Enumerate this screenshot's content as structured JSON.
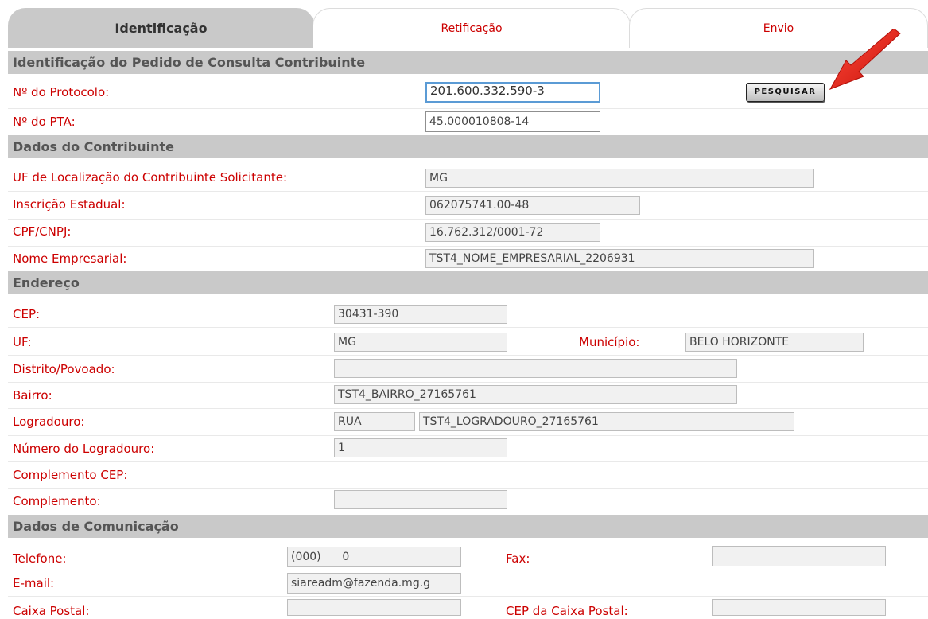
{
  "tabs": [
    {
      "label": "Identificação",
      "active": true
    },
    {
      "label": "Retificação",
      "active": false
    },
    {
      "label": "Envio",
      "active": false
    }
  ],
  "sections": {
    "identificacao": "Identificação do Pedido de Consulta Contribuinte",
    "contribuinte": "Dados do Contribuinte",
    "endereco": "Endereço",
    "comunicacao": "Dados de Comunicação"
  },
  "identificacao": {
    "protocolo_label": "Nº do Protocolo:",
    "protocolo_value": "201.600.332.590-3",
    "pta_label": "Nº do PTA:",
    "pta_value": "45.000010808-14",
    "search_label": "PESQUISAR"
  },
  "contribuinte": {
    "uf_label": "UF de Localização do Contribuinte Solicitante:",
    "uf_value": "MG",
    "ie_label": "Inscrição Estadual:",
    "ie_value": "062075741.00-48",
    "cpf_label": "CPF/CNPJ:",
    "cpf_value": "16.762.312/0001-72",
    "nome_label": "Nome Empresarial:",
    "nome_value": "TST4_NOME_EMPRESARIAL_2206931"
  },
  "endereco": {
    "cep_label": "CEP:",
    "cep_value": "30431-390",
    "uf_label": "UF:",
    "uf_value": "MG",
    "municipio_label": "Município:",
    "municipio_value": "BELO HORIZONTE",
    "distrito_label": "Distrito/Povoado:",
    "distrito_value": "",
    "bairro_label": "Bairro:",
    "bairro_value": "TST4_BAIRRO_27165761",
    "logradouro_label": "Logradouro:",
    "logradouro_tipo": "RUA",
    "logradouro_value": "TST4_LOGRADOURO_27165761",
    "numero_label": "Número do Logradouro:",
    "numero_value": "1",
    "compl_cep_label": "Complemento CEP:",
    "complemento_label": "Complemento:",
    "complemento_value": ""
  },
  "comunicacao": {
    "telefone_label": "Telefone:",
    "telefone_value": "(000)      0",
    "fax_label": "Fax:",
    "fax_value": "",
    "email_label": "E-mail:",
    "email_value": "siareadm@fazenda.mg.g",
    "caixa_label": "Caixa Postal:",
    "caixa_value": "",
    "cep_caixa_label": "CEP da Caixa Postal:",
    "cep_caixa_value": ""
  },
  "colors": {
    "label": "#cc0000",
    "section_bg": "#c9c9c9",
    "annotation_arrow": "#e8231a"
  },
  "icons": {
    "annotation": "red-arrow-icon"
  }
}
